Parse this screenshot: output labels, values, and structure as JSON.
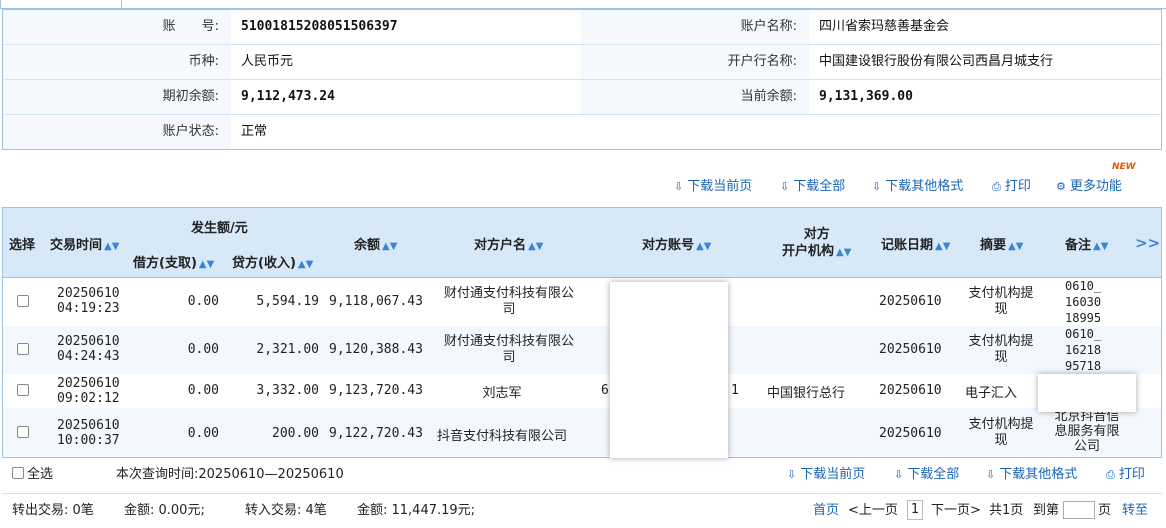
{
  "account": {
    "acct_no_label": "账　　号:",
    "acct_no": "51001815208051506397",
    "acct_name_label": "账户名称:",
    "acct_name": "四川省索玛慈善基金会",
    "currency_label": "币种:",
    "currency": "人民币元",
    "bank_label": "开户行名称:",
    "bank": "中国建设银行股份有限公司西昌月城支行",
    "open_bal_label": "期初余额:",
    "open_bal": "9,112,473.24",
    "cur_bal_label": "当前余额:",
    "cur_bal": "9,131,369.00",
    "status_label": "账户状态:",
    "status": "正常"
  },
  "actions": {
    "download_page": "下载当前页",
    "download_all": "下载全部",
    "download_other": "下载其他格式",
    "print": "打印",
    "more": "更多功能",
    "new_badge": "NEW"
  },
  "table": {
    "headers": {
      "select": "选择",
      "time": "交易时间",
      "amount_group": "发生额/元",
      "debit": "借方(支取)",
      "credit": "贷方(收入)",
      "balance": "余额",
      "counter_name": "对方户名",
      "counter_acct": "对方账号",
      "counter_bank_1": "对方",
      "counter_bank_2": "开户机构",
      "book_date": "记账日期",
      "summary": "摘要",
      "remark": "备注",
      "expand": ">>"
    },
    "rows": [
      {
        "date": "20250610",
        "time": "04:19:23",
        "debit": "0.00",
        "credit": "5,594.19",
        "balance": "9,118,067.43",
        "name_1": "财付通支付科技有限公",
        "name_2": "司",
        "acct": "",
        "bank": "",
        "book_date": "20250610",
        "summary_1": "支付机构提",
        "summary_2": "现",
        "remark_1": "0610_",
        "remark_2": "16030",
        "remark_3": "18995"
      },
      {
        "date": "20250610",
        "time": "04:24:43",
        "debit": "0.00",
        "credit": "2,321.00",
        "balance": "9,120,388.43",
        "name_1": "财付通支付科技有限公",
        "name_2": "司",
        "acct": "",
        "bank": "",
        "book_date": "20250610",
        "summary_1": "支付机构提",
        "summary_2": "现",
        "remark_1": "0610_",
        "remark_2": "16218",
        "remark_3": "95718"
      },
      {
        "date": "20250610",
        "time": "09:02:12",
        "debit": "0.00",
        "credit": "3,332.00",
        "balance": "9,123,720.43",
        "name_1": "刘志军",
        "name_2": "",
        "acct_left": "6",
        "acct_right": "1",
        "bank": "中国银行总行",
        "book_date": "20250610",
        "summary_1": "电子汇入",
        "summary_2": "",
        "remark_1": "",
        "remark_2": "",
        "remark_3": ""
      },
      {
        "date": "20250610",
        "time": "10:00:37",
        "debit": "0.00",
        "credit": "200.00",
        "balance": "9,122,720.43",
        "name_1": "抖音支付科技有限公司",
        "name_2": "",
        "acct": "",
        "bank": "",
        "book_date": "20250610",
        "summary_1": "支付机构提",
        "summary_2": "现",
        "remark_1": "北京抖音信",
        "remark_2": "息服务有限",
        "remark_3": "公司"
      }
    ]
  },
  "footer": {
    "select_all": "全选",
    "query_time": "本次查询时间:20250610—20250610",
    "download_page": "下载当前页",
    "download_all": "下载全部",
    "download_other": "下载其他格式",
    "print": "打印",
    "out_tx": "转出交易: 0笔",
    "out_amount": "金额: 0.00元;",
    "in_tx": "转入交易: 4笔",
    "in_amount": "金额: 11,447.19元;",
    "first_page": "首页",
    "prev_page": "<上一页",
    "page_no": "1",
    "next_page": "下一页>",
    "total_pages": "共1页",
    "goto_label": "到第",
    "page_unit": "页",
    "goto_btn": "转至"
  }
}
